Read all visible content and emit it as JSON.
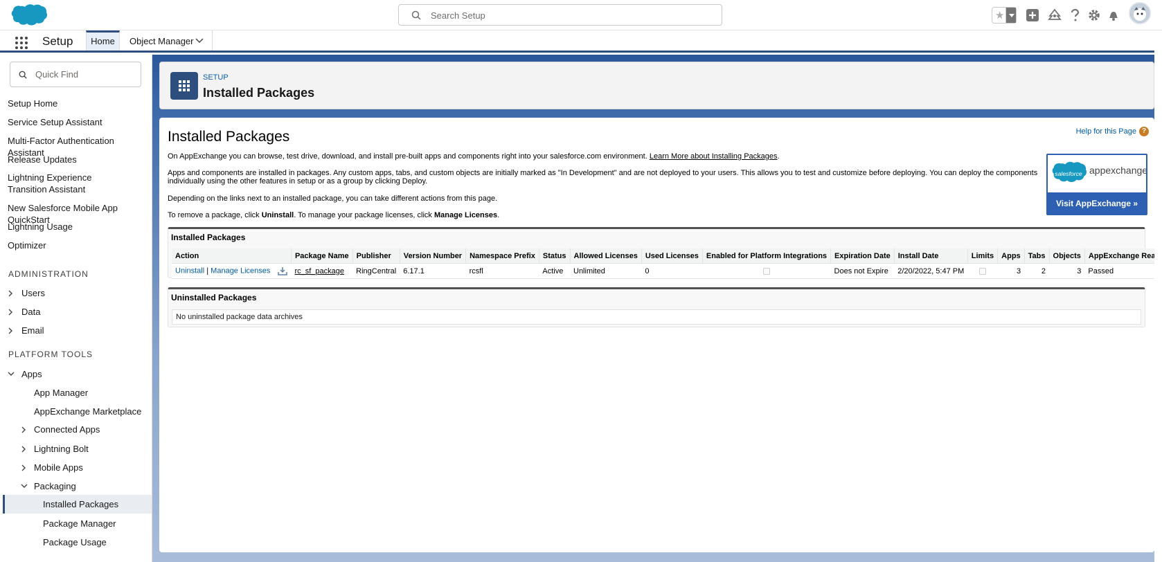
{
  "header": {
    "search_placeholder": "Search Setup"
  },
  "context_bar": {
    "app_name": "Setup",
    "tabs": [
      {
        "label": "Home"
      },
      {
        "label": "Object Manager"
      }
    ]
  },
  "sidebar": {
    "quick_find_placeholder": "Quick Find",
    "items": [
      "Setup Home",
      "Service Setup Assistant",
      "Multi-Factor Authentication Assistant",
      "Release Updates",
      "Lightning Experience Transition Assistant",
      "New Salesforce Mobile App QuickStart",
      "Lightning Usage",
      "Optimizer"
    ],
    "sections": {
      "administration": "ADMINISTRATION",
      "platform_tools": "PLATFORM TOOLS"
    },
    "admin_items": [
      "Users",
      "Data",
      "Email"
    ],
    "apps": {
      "label": "Apps",
      "children": [
        "App Manager",
        "AppExchange Marketplace",
        "Connected Apps",
        "Lightning Bolt",
        "Mobile Apps",
        "Packaging"
      ],
      "packaging_children": [
        "Installed Packages",
        "Package Manager",
        "Package Usage"
      ]
    }
  },
  "page_header": {
    "breadcrumb": "SETUP",
    "title": "Installed Packages"
  },
  "main": {
    "title": "Installed Packages",
    "help_link": "Help for this Page",
    "help_icon": "?",
    "para1_text": "On AppExchange you can browse, test drive, download, and install pre-built apps and components right into your salesforce.com environment. ",
    "para1_link": "Learn More about Installing Packages",
    "para1_end": ".",
    "para2": "Apps and components are installed in packages. Any custom apps, tabs, and custom objects are initially marked as \"In Development\" and are not deployed to your users. This allows you to test and customize before deploying. You can deploy the components individually using the other features in setup or as a group by clicking Deploy.",
    "para3": "Depending on the links next to an installed package, you can take different actions from this page.",
    "para4_a": "To remove a package, click ",
    "para4_b": "Uninstall",
    "para4_c": ". To manage your package licenses, click ",
    "para4_d": "Manage Licenses",
    "para4_e": ".",
    "appexchange": {
      "logo_text": "salesforce",
      "wordmark": "appexchange",
      "button": "Visit AppExchange »"
    },
    "installed": {
      "title": "Installed Packages",
      "columns": [
        "Action",
        "Package Name",
        "Publisher",
        "Version Number",
        "Namespace Prefix",
        "Status",
        "Allowed Licenses",
        "Used Licenses",
        "Enabled for Platform Integrations",
        "Expiration Date",
        "Install Date",
        "Limits",
        "Apps",
        "Tabs",
        "Objects",
        "AppExchange Ready"
      ],
      "row": {
        "uninstall": "Uninstall",
        "sep": "|",
        "manage": "Manage Licenses",
        "package_name": "rc_sf_package",
        "publisher": "RingCentral",
        "version": "6.17.1",
        "namespace": "rcsfl",
        "status": "Active",
        "allowed": "Unlimited",
        "used": "0",
        "expiration": "Does not Expire",
        "install_date": "2/20/2022, 5:47 PM",
        "apps": "3",
        "tabs": "2",
        "objects": "3",
        "appexchange_ready": "Passed"
      }
    },
    "uninstalled": {
      "title": "Uninstalled Packages",
      "empty": "No uninstalled package data archives"
    }
  },
  "colors": {
    "brand_blue": "#2e4f7e",
    "link_blue": "#015ba7",
    "salesforce_cloud": "#1798c1"
  }
}
